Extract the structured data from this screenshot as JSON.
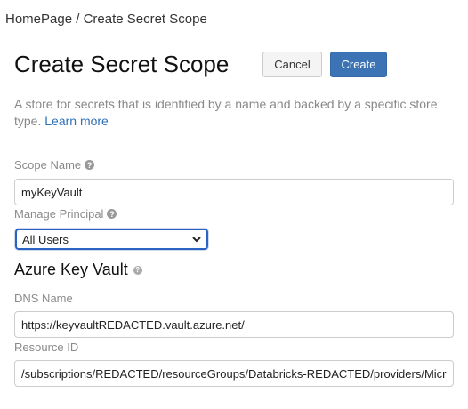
{
  "breadcrumb": {
    "home": "HomePage",
    "separator": " / ",
    "current": "Create Secret Scope"
  },
  "header": {
    "title": "Create Secret Scope",
    "cancel_label": "Cancel",
    "create_label": "Create"
  },
  "description": {
    "text": "A store for secrets that is identified by a name and backed by a specific store type. ",
    "link": "Learn more"
  },
  "form": {
    "scope_name": {
      "label": "Scope Name",
      "value": "myKeyVault"
    },
    "manage_principal": {
      "label": "Manage Principal",
      "selected": "All Users"
    },
    "azure_key_vault": {
      "heading": "Azure Key Vault",
      "dns_name": {
        "label": "DNS Name",
        "value": "https://keyvaultREDACTED.vault.azure.net/"
      },
      "resource_id": {
        "label": "Resource ID",
        "value": "/subscriptions/REDACTED/resourceGroups/Databricks-REDACTED/providers/Micr"
      }
    }
  },
  "colors": {
    "primary": "#3b73b4",
    "link": "#2f6fb6",
    "focus": "#2a63c4"
  }
}
